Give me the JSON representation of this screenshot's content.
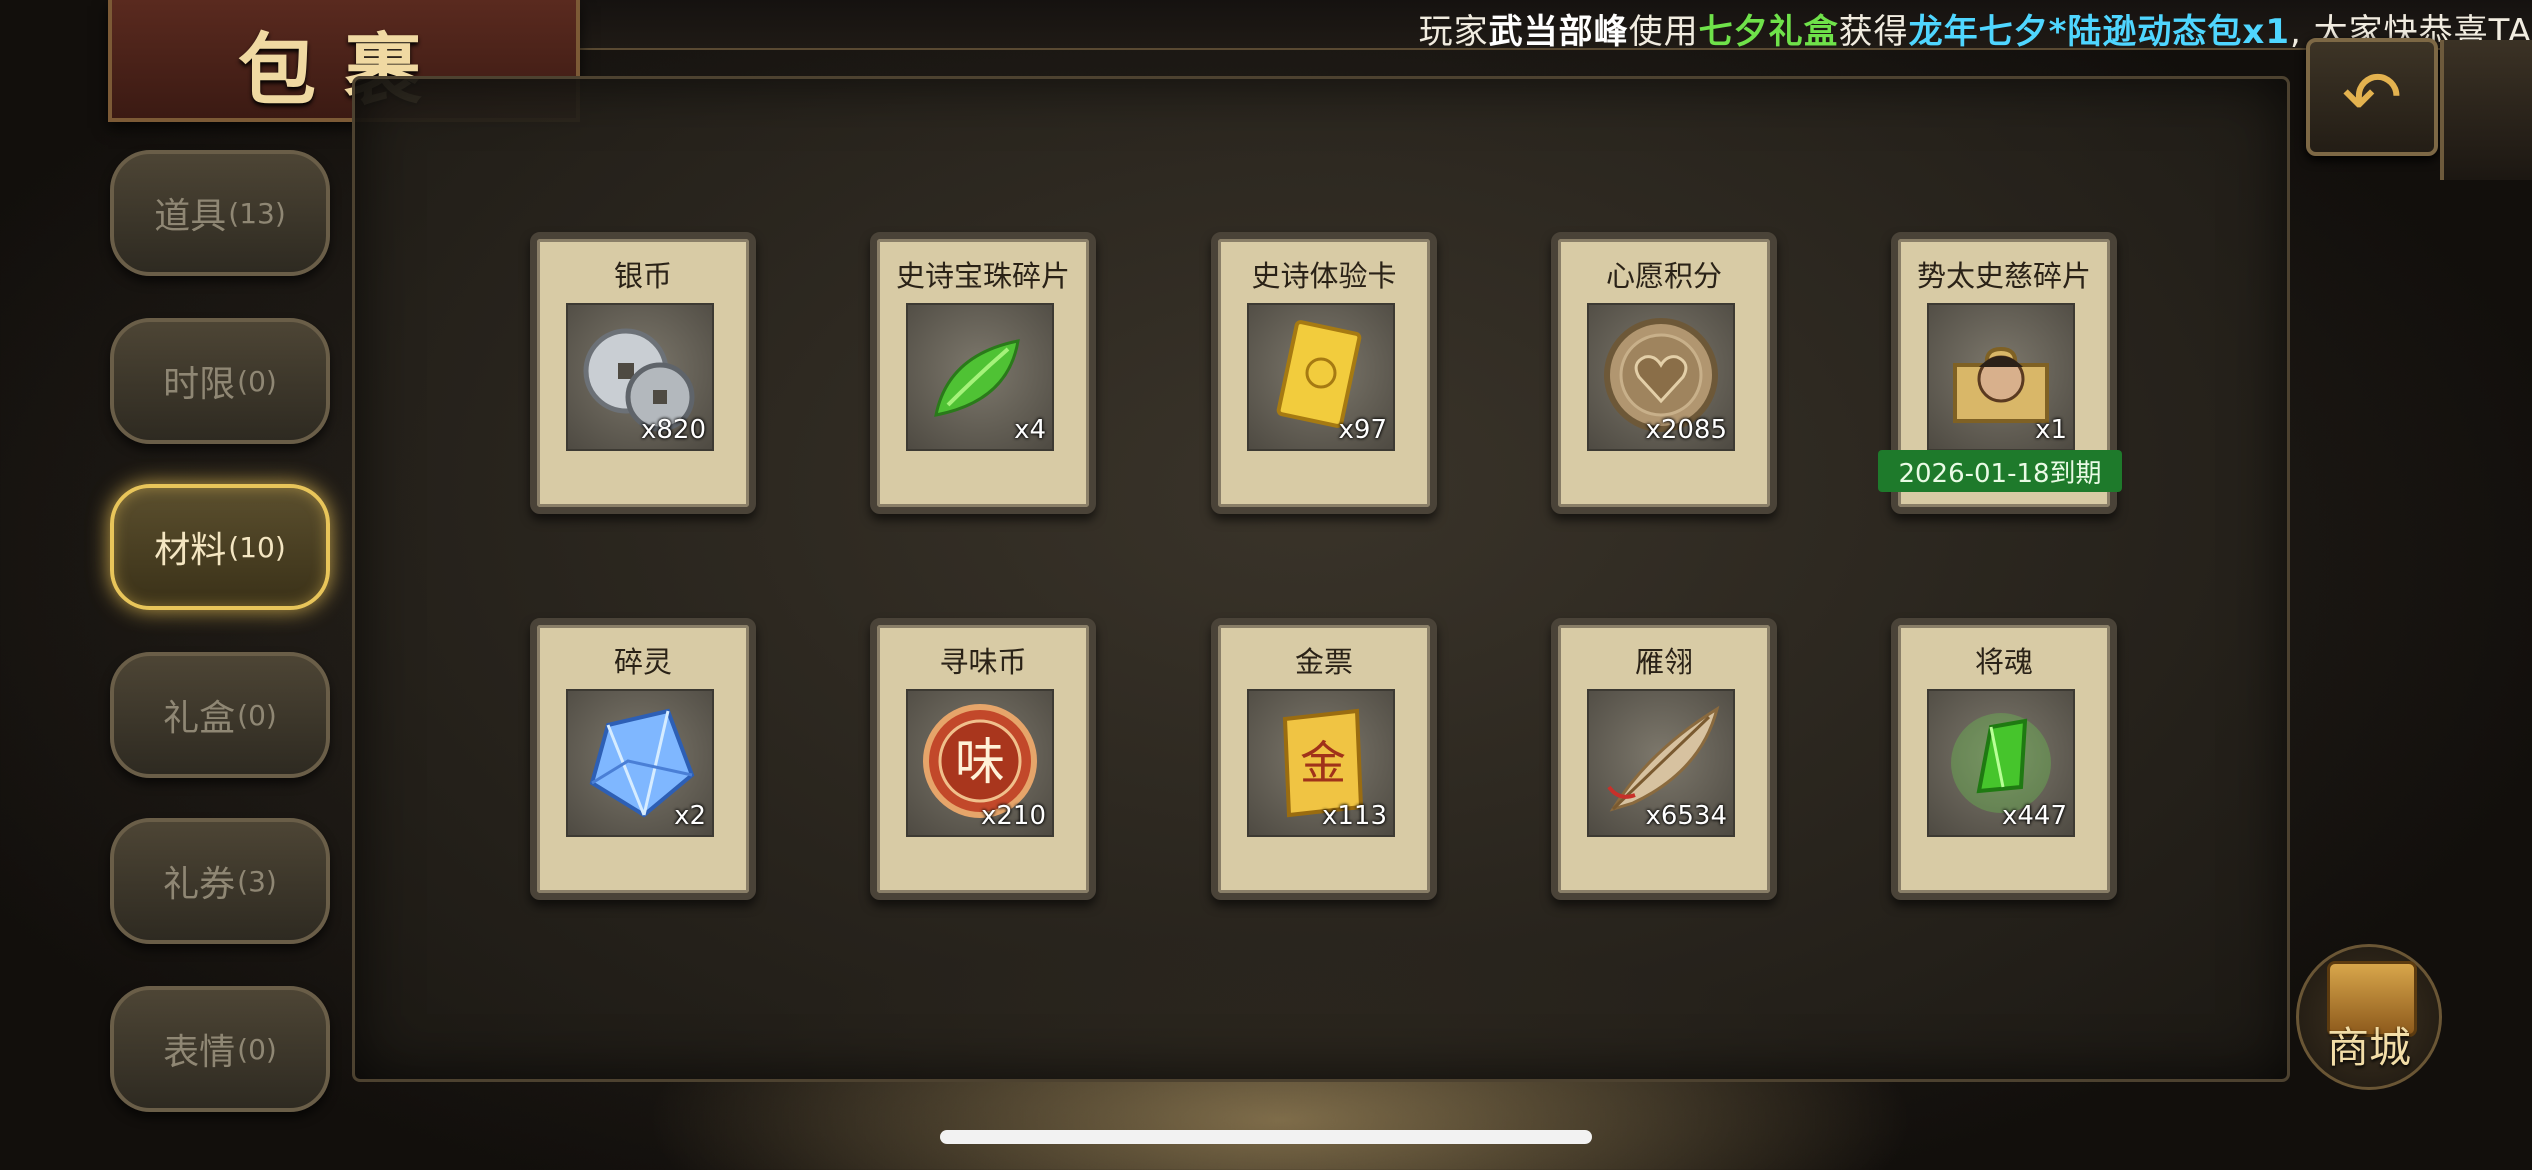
{
  "ticker": {
    "p1": "玩家",
    "player": "武当部峰",
    "p2": "使用",
    "item_used": "七夕礼盒",
    "p3": "获得",
    "reward": "龙年七夕*陆逊动态包x1",
    "p4": ", 大家快恭喜TA"
  },
  "header": {
    "title": "包裹"
  },
  "tabs": [
    {
      "label": "道具",
      "count": "(13)"
    },
    {
      "label": "时限",
      "count": "(0)"
    },
    {
      "label": "材料",
      "count": "(10)"
    },
    {
      "label": "礼盒",
      "count": "(0)"
    },
    {
      "label": "礼券",
      "count": "(3)"
    },
    {
      "label": "表情",
      "count": "(0)"
    }
  ],
  "items": [
    {
      "name": "银币",
      "qty": "x820",
      "icon": "silver-coin-icon"
    },
    {
      "name": "史诗宝珠碎片",
      "qty": "x4",
      "icon": "green-leaf-shard-icon"
    },
    {
      "name": "史诗体验卡",
      "qty": "x97",
      "icon": "gold-card-icon"
    },
    {
      "name": "心愿积分",
      "qty": "x2085",
      "icon": "heart-coin-icon"
    },
    {
      "name": "势太史慈碎片",
      "qty": "x1",
      "icon": "general-puzzle-piece-icon",
      "expiry": "2026-01-18到期"
    },
    {
      "name": "碎灵",
      "qty": "x2",
      "icon": "blue-crystal-icon"
    },
    {
      "name": "寻味币",
      "qty": "x210",
      "icon": "flavor-coin-icon",
      "glyph": "味"
    },
    {
      "name": "金票",
      "qty": "x113",
      "icon": "gold-scroll-icon",
      "glyph": "金"
    },
    {
      "name": "雁翎",
      "qty": "x6534",
      "icon": "feather-icon"
    },
    {
      "name": "将魂",
      "qty": "x447",
      "icon": "green-soul-crystal-icon"
    }
  ],
  "shop": {
    "label": "商城"
  },
  "icons": {
    "back": "back-arrow-icon",
    "shop": "treasure-chest-icon"
  }
}
